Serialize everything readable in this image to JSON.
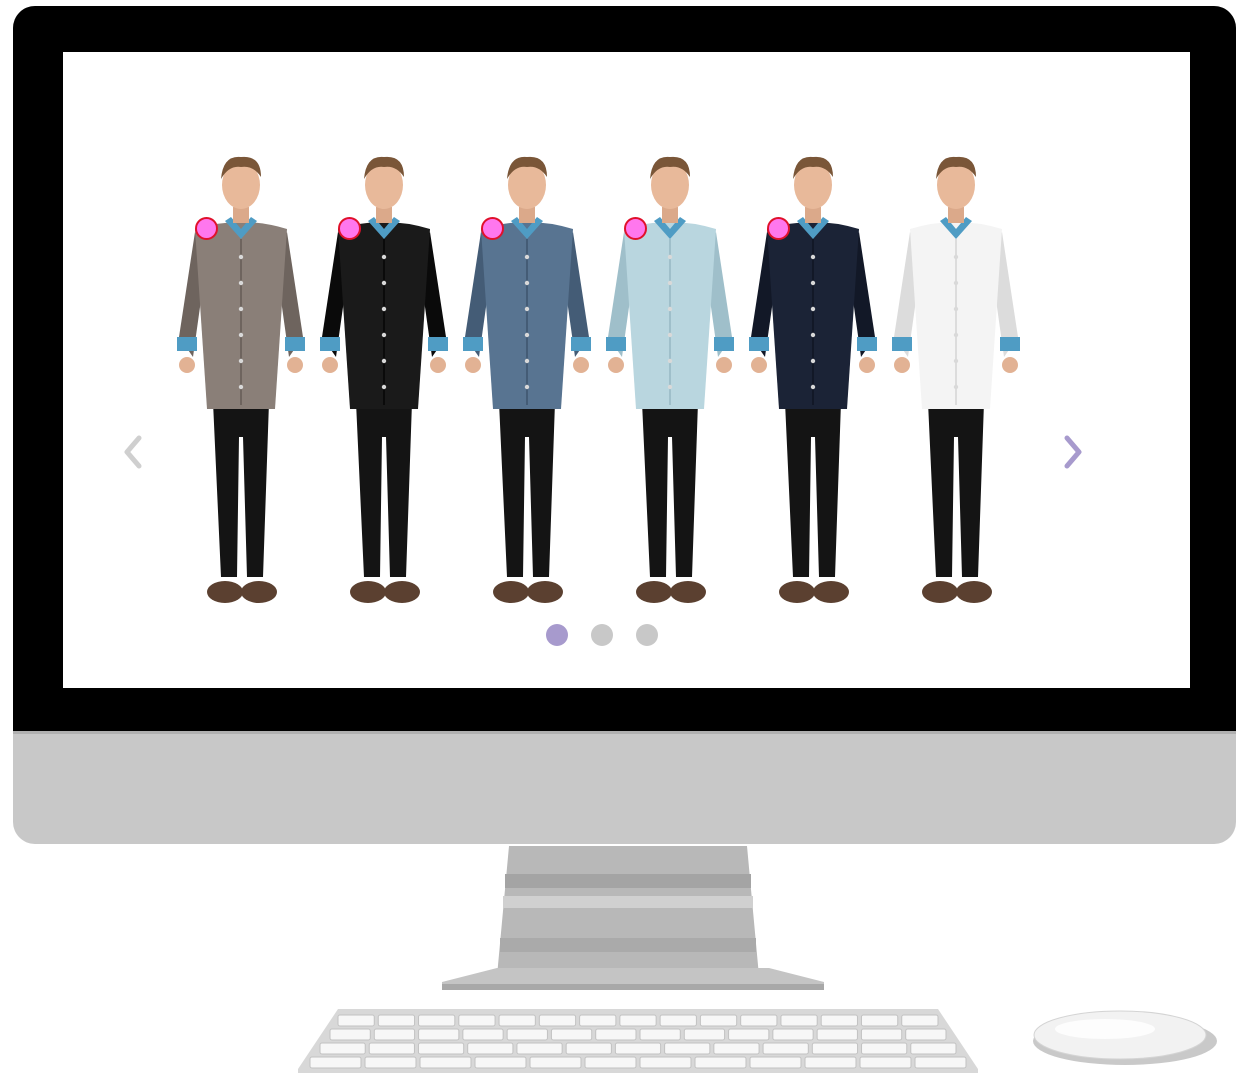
{
  "slider": {
    "models": [
      {
        "name": "model-taupe-shirt",
        "shirt": "#8a7f78",
        "shirt_dark": "#6e645e"
      },
      {
        "name": "model-black-shirt",
        "shirt": "#1a1a1a",
        "shirt_dark": "#0a0a0a"
      },
      {
        "name": "model-denim-shirt",
        "shirt": "#587491",
        "shirt_dark": "#445c76"
      },
      {
        "name": "model-lightblue-shirt",
        "shirt": "#b9d6df",
        "shirt_dark": "#9fbfca"
      },
      {
        "name": "model-navy-shirt",
        "shirt": "#1b2336",
        "shirt_dark": "#121827"
      },
      {
        "name": "model-white-shirt",
        "shirt": "#f4f4f4",
        "shirt_dark": "#dcdcdc"
      }
    ],
    "hotspot_count": 5,
    "prev_icon": "chevron-left-icon",
    "next_icon": "chevron-right-icon",
    "dots": [
      {
        "active": true
      },
      {
        "active": false
      },
      {
        "active": false
      }
    ]
  },
  "colors": {
    "active_dot": "#a79acd",
    "inactive_dot": "#c8c8c8",
    "hotspot_fill": "#ff77ee",
    "hotspot_border": "#e0112b",
    "next_arrow": "#a79acd",
    "prev_arrow": "#cfcfcf",
    "bezel": "#000000",
    "chassis": "#c8c8c8"
  }
}
